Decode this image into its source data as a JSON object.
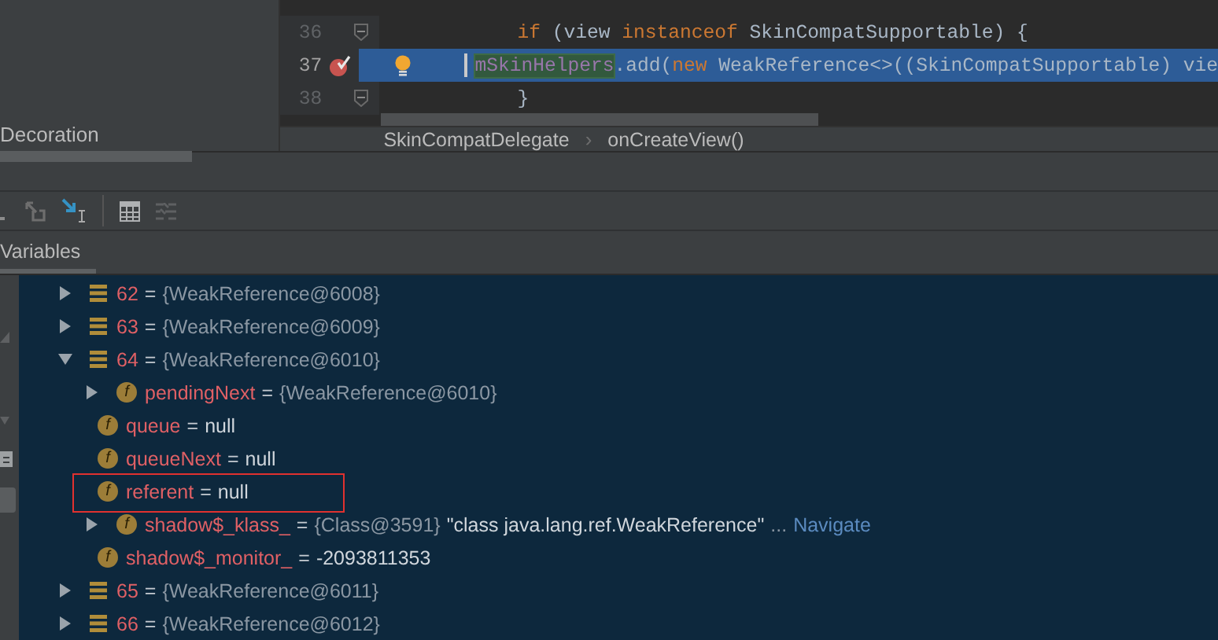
{
  "project_panel": {
    "item": "Decoration"
  },
  "editor": {
    "lines": [
      {
        "number": "36",
        "fold": true,
        "breakpoint": false,
        "current": false,
        "intention": false,
        "tokens": [
          {
            "text": "if",
            "kind": "keyword"
          },
          {
            "text": " (view ",
            "kind": "plain"
          },
          {
            "text": "instanceof",
            "kind": "keyword"
          },
          {
            "text": " SkinCompatSupportable) {",
            "kind": "plain"
          }
        ]
      },
      {
        "number": "37",
        "fold": false,
        "breakpoint": true,
        "current": true,
        "intention": true,
        "tokens": [
          {
            "text": "mSkinHelpers",
            "kind": "match"
          },
          {
            "text": ".add(",
            "kind": "plain"
          },
          {
            "text": "new",
            "kind": "keyword"
          },
          {
            "text": " WeakReference<>((SkinCompatSupportable) vie",
            "kind": "plain"
          }
        ]
      },
      {
        "number": "38",
        "fold": true,
        "breakpoint": false,
        "current": false,
        "intention": false,
        "tokens": [
          {
            "text": "}",
            "kind": "plain"
          }
        ]
      }
    ]
  },
  "breadcrumbs": [
    {
      "label": "SkinCompatDelegate"
    },
    {
      "label": "onCreateView()"
    }
  ],
  "breadcrumb_separator": "›",
  "debug_tabs": [
    {
      "label": "Variables",
      "selected": true
    }
  ],
  "variables": [
    {
      "kind": "element",
      "name": "62",
      "sign": "=",
      "value": "{WeakReference@6008}",
      "expandable": true,
      "expanded": false,
      "annotated": false
    },
    {
      "kind": "element",
      "name": "63",
      "sign": "=",
      "value": "{WeakReference@6009}",
      "expandable": true,
      "expanded": false,
      "annotated": false
    },
    {
      "kind": "element",
      "name": "64",
      "sign": "=",
      "value": "{WeakReference@6010}",
      "expandable": true,
      "expanded": true,
      "annotated": false,
      "children": [
        {
          "kind": "field",
          "icon": "f",
          "name": "pendingNext",
          "sign": "=",
          "value": "{WeakReference@6010}",
          "expandable": true,
          "expanded": false,
          "annotated": false
        },
        {
          "kind": "field",
          "icon": "f",
          "name": "queue",
          "sign": "=",
          "value": "null",
          "expandable": false,
          "expanded": false,
          "annotated": false
        },
        {
          "kind": "field",
          "icon": "f",
          "name": "queueNext",
          "sign": "=",
          "value": "null",
          "expandable": false,
          "expanded": false,
          "annotated": false
        },
        {
          "kind": "field",
          "icon": "f",
          "name": "referent",
          "sign": "=",
          "value": "null",
          "expandable": false,
          "expanded": false,
          "annotated": true
        },
        {
          "kind": "field",
          "icon": "f",
          "name": "shadow$_klass_",
          "sign": "=",
          "value": "{Class@3591}",
          "string": "\"class java.lang.ref.WeakReference\"",
          "more": "...",
          "link": "Navigate",
          "expandable": true,
          "expanded": false,
          "annotated": false
        },
        {
          "kind": "field",
          "icon": "f",
          "name": "shadow$_monitor_",
          "sign": "=",
          "value": "-2093811353",
          "expandable": false,
          "expanded": false,
          "annotated": false
        }
      ]
    },
    {
      "kind": "element",
      "name": "65",
      "sign": "=",
      "value": "{WeakReference@6011}",
      "expandable": true,
      "expanded": false,
      "annotated": false
    },
    {
      "kind": "element",
      "name": "66",
      "sign": "=",
      "value": "{WeakReference@6012}",
      "expandable": true,
      "expanded": false,
      "annotated": false
    }
  ]
}
